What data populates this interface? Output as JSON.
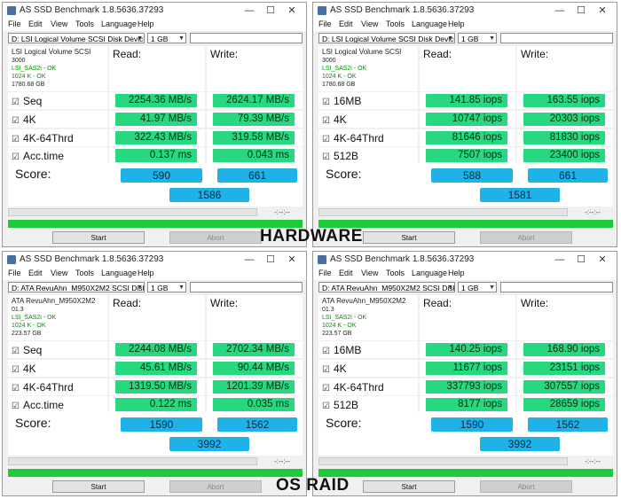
{
  "app": {
    "title": "AS SSD Benchmark 1.8.5636.37293",
    "menu": [
      "File",
      "Edit",
      "View",
      "Tools",
      "Language",
      "Help"
    ],
    "window_buttons": {
      "minimize": "—",
      "maximize": "☐",
      "close": "✕"
    },
    "dropdown_arrow": "▼",
    "checkbox_glyph": "☑",
    "read_header": "Read:",
    "write_header": "Write:",
    "score_label": "Score:",
    "elapsed": "-:--:--",
    "start_label": "Start",
    "abort_label": "Abort"
  },
  "captions": {
    "top": "HARDWARE",
    "bottom": "OS RAID"
  },
  "colors": {
    "value_green": "#28d880",
    "score_blue": "#1fb2e8",
    "progress_green": "#1fca3a"
  },
  "windows": [
    {
      "drive": "D: LSI Logical Volume SCSI Disk Device",
      "size": "1 GB",
      "info": {
        "device": "LSI Logical Volume SCSI",
        "line2": "3000",
        "line3": "LSI_SAS2i - OK",
        "line4": "1024 K - OK",
        "line5": "1780.68 GB"
      },
      "rows": [
        {
          "label": "Seq",
          "read": "2254.36 MB/s",
          "write": "2624.17 MB/s"
        },
        {
          "label": "4K",
          "read": "41.97 MB/s",
          "write": "79.39 MB/s"
        },
        {
          "label": "4K-64Thrd",
          "read": "322.43 MB/s",
          "write": "319.58 MB/s"
        },
        {
          "label": "Acc.time",
          "read": "0.137 ms",
          "write": "0.043 ms"
        }
      ],
      "score": {
        "read": "590",
        "write": "661",
        "total": "1586"
      }
    },
    {
      "drive": "D: LSI Logical Volume SCSI Disk Device",
      "size": "1 GB",
      "info": {
        "device": "LSI Logical Volume SCSI",
        "line2": "3000",
        "line3": "LSI_SAS2i - OK",
        "line4": "1024 K - OK",
        "line5": "1780.68 GB"
      },
      "rows": [
        {
          "label": "16MB",
          "read": "141.85 iops",
          "write": "163.55 iops"
        },
        {
          "label": "4K",
          "read": "10747 iops",
          "write": "20303 iops"
        },
        {
          "label": "4K-64Thrd",
          "read": "81646 iops",
          "write": "81830 iops"
        },
        {
          "label": "512B",
          "read": "7507 iops",
          "write": "23400 iops"
        }
      ],
      "score": {
        "read": "588",
        "write": "661",
        "total": "1581"
      }
    },
    {
      "drive": "D: ATA RevuAhn_M950X2M2 SCSI Disk D",
      "size": "1 GB",
      "info": {
        "device": "ATA RevuAhn_M950X2M2",
        "line2": "01.3",
        "line3": "LSI_SAS2i - OK",
        "line4": "1024 K - OK",
        "line5": "223.57 GB"
      },
      "rows": [
        {
          "label": "Seq",
          "read": "2244.08 MB/s",
          "write": "2702.34 MB/s"
        },
        {
          "label": "4K",
          "read": "45.61 MB/s",
          "write": "90.44 MB/s"
        },
        {
          "label": "4K-64Thrd",
          "read": "1319.50 MB/s",
          "write": "1201.39 MB/s"
        },
        {
          "label": "Acc.time",
          "read": "0.122 ms",
          "write": "0.035 ms"
        }
      ],
      "score": {
        "read": "1590",
        "write": "1562",
        "total": "3992"
      }
    },
    {
      "drive": "D: ATA RevuAhn_M950X2M2 SCSI Disk D",
      "size": "1 GB",
      "info": {
        "device": "ATA RevuAhn_M950X2M2",
        "line2": "01.3",
        "line3": "LSI_SAS2i - OK",
        "line4": "1024 K - OK",
        "line5": "223.57 GB"
      },
      "rows": [
        {
          "label": "16MB",
          "read": "140.25 iops",
          "write": "168.90 iops"
        },
        {
          "label": "4K",
          "read": "11677 iops",
          "write": "23151 iops"
        },
        {
          "label": "4K-64Thrd",
          "read": "337793 iops",
          "write": "307557 iops"
        },
        {
          "label": "512B",
          "read": "8177 iops",
          "write": "28659 iops"
        }
      ],
      "score": {
        "read": "1590",
        "write": "1562",
        "total": "3992"
      }
    }
  ]
}
